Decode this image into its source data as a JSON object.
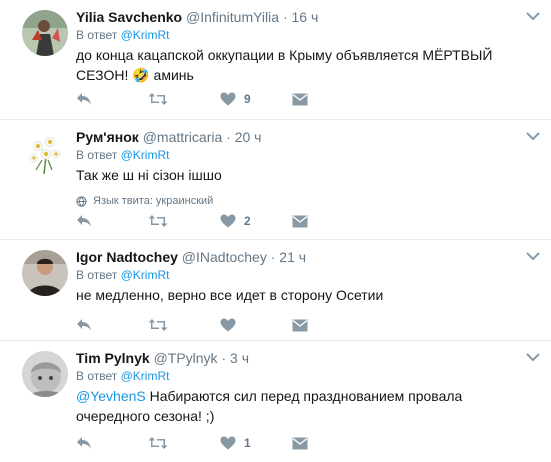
{
  "tweets": [
    {
      "fullname": "Yilia Savchenko",
      "handle": "@InfinitumYilia",
      "time": "16 ч",
      "reply_prefix": "В ответ",
      "reply_to": "@KrimRt",
      "text": "до конца кацапской оккупации в Крыму объявляется МЁРТВЫЙ СЕЗОН! 🤣 аминь",
      "likes": "9"
    },
    {
      "fullname": "Рум'янок",
      "handle": "@mattricaria",
      "time": "20 ч",
      "reply_prefix": "В ответ",
      "reply_to": "@KrimRt",
      "text": "Так же ш ні сізон ішшо",
      "language_note": "Язык твита: украинский",
      "likes": "2"
    },
    {
      "fullname": "Igor Nadtochey",
      "handle": "@INadtochey",
      "time": "21 ч",
      "reply_prefix": "В ответ",
      "reply_to": "@KrimRt",
      "text": "не медленно, верно все идет в сторону Осетии",
      "likes": ""
    },
    {
      "fullname": "Tim Pylnyk",
      "handle": "@TPylnyk",
      "time": "3 ч",
      "reply_prefix": "В ответ",
      "reply_to": "@KrimRt",
      "text_mention": "@YevhenS",
      "text": " Набираются сил перед празднованием провала очередного сезона! ;)",
      "likes": "1"
    }
  ],
  "colors": {
    "accent": "#1b95e0",
    "muted": "#657786",
    "icon": "#8899a6",
    "divider": "#e6ecf0"
  },
  "icons": [
    "reply-icon",
    "retweet-icon",
    "like-icon",
    "message-icon",
    "caret-down-icon",
    "globe-icon"
  ]
}
